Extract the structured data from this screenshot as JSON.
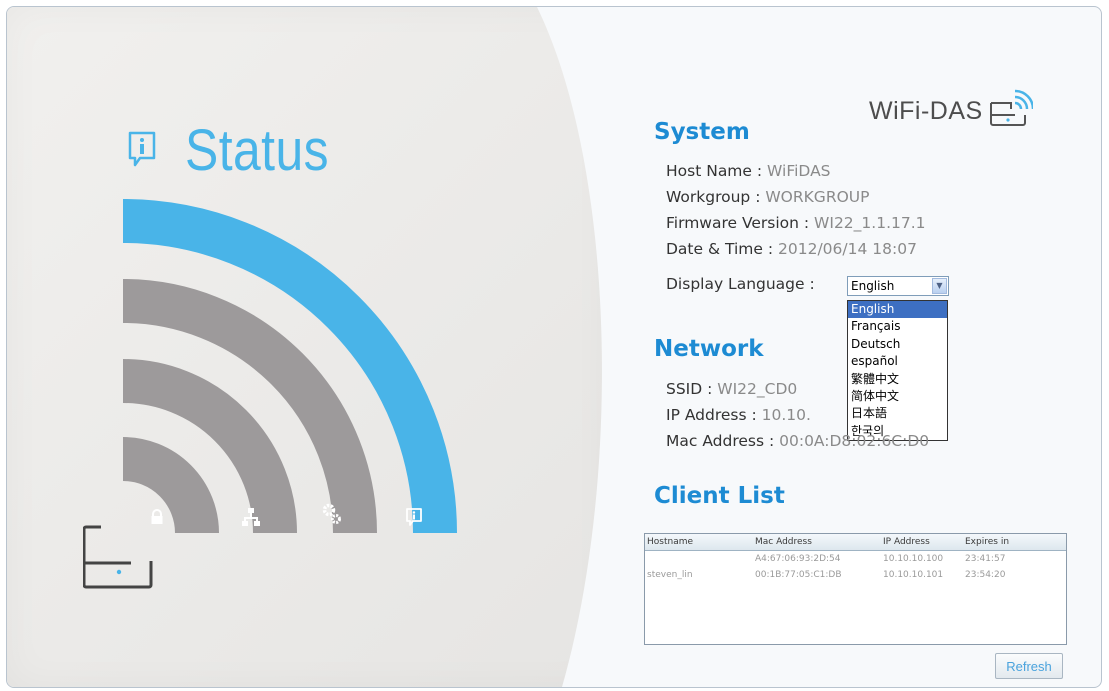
{
  "brand": {
    "name": "WiFi-DAS",
    "icon": "wifi-drive-icon"
  },
  "heading": {
    "title": "Status",
    "icon": "info-icon"
  },
  "arc_icons": [
    "lock-icon",
    "network-icon",
    "gears-icon",
    "info-icon"
  ],
  "colors": {
    "accent": "#49b4e8",
    "section_title": "#1d8bd3",
    "arc_gray": "#9d9a9b"
  },
  "system": {
    "title": "System",
    "host_name_label": "Host Name : ",
    "host_name": "WiFiDAS",
    "workgroup_label": "Workgroup : ",
    "workgroup": "WORKGROUP",
    "firmware_label": "Firmware Version : ",
    "firmware": "WI22_1.1.17.1",
    "datetime_label": "Date & Time : ",
    "datetime": "2012/06/14  18:07",
    "language_label": "Display Language : ",
    "language_selected": "English",
    "language_options": [
      "English",
      "Français",
      "Deutsch",
      "español",
      "繁體中文",
      "简体中文",
      "日本語",
      "한국의"
    ]
  },
  "network": {
    "title": "Network",
    "ssid_label": "SSID : ",
    "ssid": "WI22_CD0",
    "ip_label": "IP Address : ",
    "ip": "10.10.",
    "mac_label": "Mac Address : ",
    "mac": "00:0A:D8:02:6C:D0"
  },
  "client_list": {
    "title": "Client List",
    "columns": [
      "Hostname",
      "Mac Address",
      "IP Address",
      "Expires in"
    ],
    "rows": [
      [
        "",
        "A4:67:06:93:2D:54",
        "10.10.10.100",
        "23:41:57"
      ],
      [
        "steven_lin",
        "00:1B:77:05:C1:DB",
        "10.10.10.101",
        "23:54:20"
      ]
    ],
    "refresh_label": "Refresh"
  }
}
